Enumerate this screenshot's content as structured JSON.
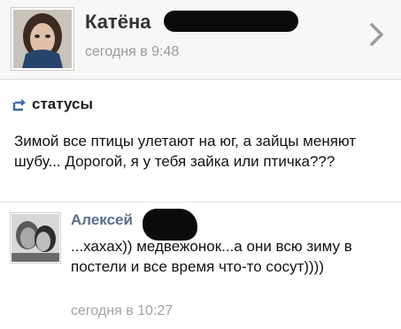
{
  "post": {
    "author_name": "Катёна",
    "time": "сегодня в 9:48",
    "section_label": "статусы",
    "status_text": "Зимой все птицы улетают на юг, а зайцы меняют шубу... Дорогой, я у тебя зайка или птичка???"
  },
  "comment": {
    "author_name": "Алексей",
    "text": "...хахах)) медвежонок...а они всю зиму в постели и все время что-то сосут))))",
    "time": "сегодня в 10:27"
  },
  "icons": {
    "chevron": "chevron-right-icon",
    "share": "share-arrow-icon"
  },
  "colors": {
    "comment_author": "#5b6f8c",
    "section_icon": "#3b6aa8",
    "timestamp": "#9a9a9a"
  }
}
